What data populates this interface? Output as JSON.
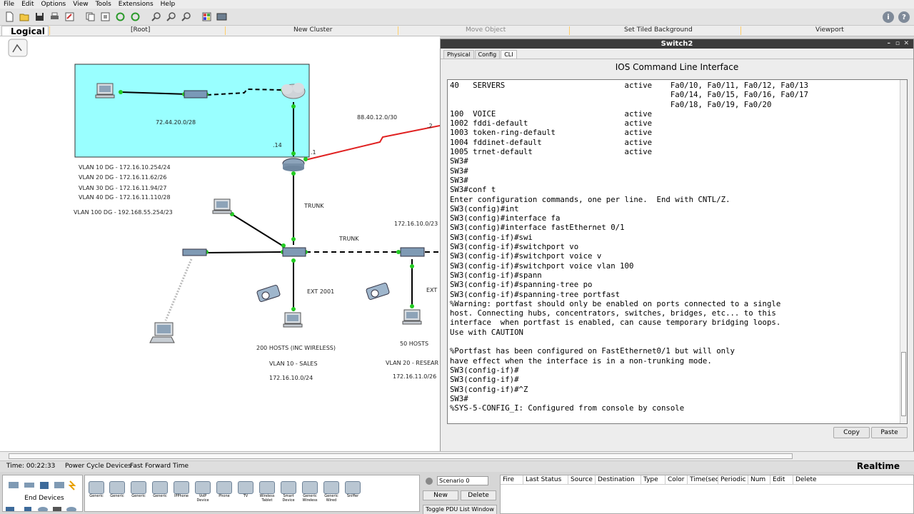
{
  "menu": [
    "File",
    "Edit",
    "Options",
    "View",
    "Tools",
    "Extensions",
    "Help"
  ],
  "toolbar_icons": [
    "new-icon",
    "open-icon",
    "save-icon",
    "print-icon",
    "activity-wizard-icon",
    "copy-icon",
    "paste-icon",
    "undo-icon",
    "redo-icon",
    "zoom-in-icon",
    "zoom-reset-icon",
    "zoom-out-icon",
    "palette-icon",
    "custom-device-icon"
  ],
  "logical_bar": {
    "label": "Logical",
    "root": "[Root]",
    "new_cluster": "New Cluster",
    "move_object": "Move Object",
    "tiled_background": "Set Tiled Background",
    "viewport": "Viewport"
  },
  "topology": {
    "labels": {
      "subnet_top": "72.44.20.0/28",
      "isp_link": "88.40.12.0/30",
      "dot2": ".2",
      "dot14": ".14",
      "dot1": ".1",
      "vlan10dg": "VLAN 10 DG - 172.16.10.254/24",
      "vlan20dg": "VLAN 20 DG - 172.16.11.62/26",
      "vlan30dg": "VLAN 30 DG - 172.16.11.94/27",
      "vlan40dg": "VLAN 40 DG - 172.16.11.110/28",
      "vlan100dg": "VLAN 100 DG - 192.168.55.254/23",
      "trunk1": "TRUNK",
      "trunk2": "TRUNK",
      "subnet_right": "172.16.10.0/23",
      "ext2001": "EXT 2001",
      "ext_right": "EXT",
      "hosts200": "200 HOSTS (INC WIRELESS)",
      "vlan10sales": "VLAN 10 - SALES",
      "subnet_sales": "172.16.10.0/24",
      "hosts50": "50 HOSTS",
      "vlan20research": "VLAN 20 - RESEAR",
      "subnet_research": "172.16.11.0/26"
    }
  },
  "switch_window": {
    "title": "Switch2",
    "tabs": [
      "Physical",
      "Config",
      "CLI"
    ],
    "active_tab": "CLI",
    "header": "IOS Command Line Interface",
    "terminal_lines": [
      "40   SERVERS                          active    Fa0/10, Fa0/11, Fa0/12, Fa0/13",
      "                                                Fa0/14, Fa0/15, Fa0/16, Fa0/17",
      "                                                Fa0/18, Fa0/19, Fa0/20",
      "100  VOICE                            active",
      "1002 fddi-default                     active",
      "1003 token-ring-default               active",
      "1004 fddinet-default                  active",
      "1005 trnet-default                    active",
      "SW3#",
      "SW3#",
      "SW3#",
      "SW3#conf t",
      "Enter configuration commands, one per line.  End with CNTL/Z.",
      "SW3(config)#int",
      "SW3(config)#interface fa",
      "SW3(config)#interface fastEthernet 0/1",
      "SW3(config-if)#swi",
      "SW3(config-if)#switchport vo",
      "SW3(config-if)#switchport voice v",
      "SW3(config-if)#switchport voice vlan 100",
      "SW3(config-if)#spann",
      "SW3(config-if)#spanning-tree po",
      "SW3(config-if)#spanning-tree portfast",
      "%Warning: portfast should only be enabled on ports connected to a single",
      "host. Connecting hubs, concentrators, switches, bridges, etc... to this",
      "interface  when portfast is enabled, can cause temporary bridging loops.",
      "Use with CAUTION",
      "",
      "%Portfast has been configured on FastEthernet0/1 but will only",
      "have effect when the interface is in a non-trunking mode.",
      "SW3(config-if)#",
      "SW3(config-if)#",
      "SW3(config-if)#^Z",
      "SW3#",
      "%SYS-5-CONFIG_I: Configured from console by console",
      ""
    ],
    "copy_label": "Copy",
    "paste_label": "Paste"
  },
  "status": {
    "time": "Time: 00:22:33",
    "power_cycle": "Power Cycle Devices",
    "fast_forward": "Fast Forward Time",
    "mode": "Realtime"
  },
  "device_panel": {
    "category_label": "End Devices",
    "devices": [
      "Generic",
      "Generic",
      "Generic",
      "Generic",
      "IPPhone",
      "VoIP Device",
      "Phone",
      "TV",
      "Wireless Tablet",
      "Smart Device",
      "Generic Wireless",
      "Generic Wired",
      "Sniffer"
    ]
  },
  "scenario": {
    "selected": "Scenario 0",
    "new_label": "New",
    "delete_label": "Delete",
    "toggle_label": "Toggle PDU List Window"
  },
  "pdu_columns": [
    "Fire",
    "Last Status",
    "Source",
    "Destination",
    "Type",
    "Color",
    "Time(sec)",
    "Periodic",
    "Num",
    "Edit",
    "Delete"
  ],
  "colors": {
    "cloud_area": "#99ffff",
    "red_link": "#e02020",
    "green_port": "#22cc22"
  }
}
